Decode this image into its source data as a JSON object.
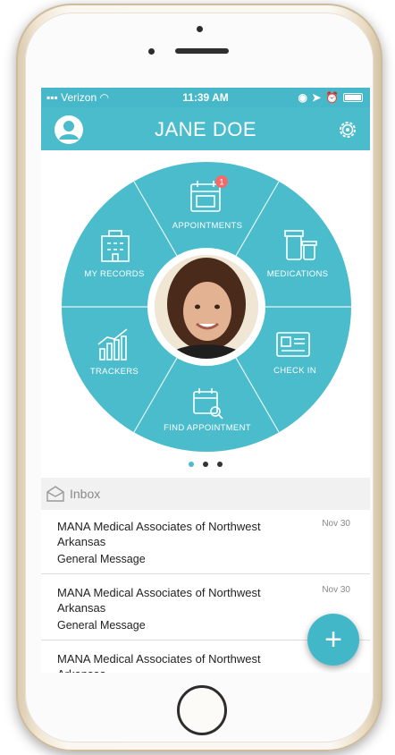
{
  "status_bar": {
    "carrier": "Verizon",
    "time": "11:39 AM"
  },
  "header": {
    "title": "JANE DOE",
    "avatar_icon": "user-circle-icon",
    "settings_icon": "gear-icon"
  },
  "wheel": {
    "segments": [
      {
        "label": "APPOINTMENTS",
        "icon": "calendar-icon",
        "badge": "1"
      },
      {
        "label": "MEDICATIONS",
        "icon": "pill-bottles-icon"
      },
      {
        "label": "CHECK IN",
        "icon": "id-card-icon"
      },
      {
        "label": "FIND APPOINTMENT",
        "icon": "calendar-search-icon"
      },
      {
        "label": "TRACKERS",
        "icon": "chart-up-icon"
      },
      {
        "label": "MY RECORDS",
        "icon": "building-icon"
      }
    ],
    "center": "profile-photo"
  },
  "pager": {
    "count": 3,
    "active": 0
  },
  "inbox": {
    "label": "Inbox",
    "icon": "envelope-open-icon",
    "messages": [
      {
        "sender": "MANA Medical Associates of Northwest Arkansas",
        "type": "General Message",
        "date": "Nov 30"
      },
      {
        "sender": "MANA Medical Associates of Northwest Arkansas",
        "type": "General Message",
        "date": "Nov 30"
      },
      {
        "sender": "MANA Medical Associates of Northwest Arkansas",
        "type": "",
        "date": ""
      }
    ]
  },
  "fab": {
    "label": "+"
  },
  "colors": {
    "accent": "#4bbccc",
    "badge": "#f26b6b"
  }
}
